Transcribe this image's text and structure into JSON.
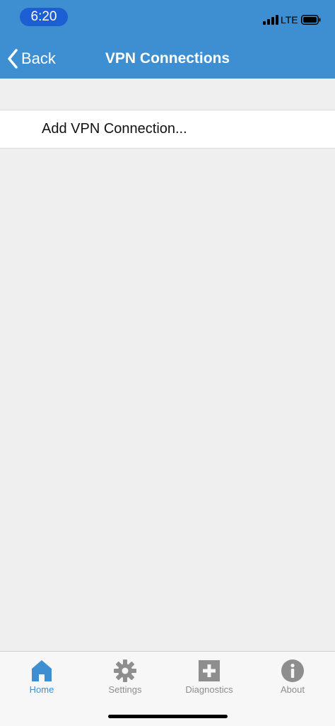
{
  "status_bar": {
    "time": "6:20",
    "network": "LTE"
  },
  "header": {
    "back_label": "Back",
    "title": "VPN Connections",
    "background_color": "#3d8fd1"
  },
  "list": {
    "items": [
      {
        "label": "Add VPN Connection..."
      }
    ]
  },
  "tabbar": {
    "tabs": [
      {
        "label": "Home",
        "icon": "home-icon",
        "active": true
      },
      {
        "label": "Settings",
        "icon": "gear-icon",
        "active": false
      },
      {
        "label": "Diagnostics",
        "icon": "plus-square-icon",
        "active": false
      },
      {
        "label": "About",
        "icon": "info-icon",
        "active": false
      }
    ],
    "active_color": "#3d8fd1",
    "inactive_color": "#8e8e8e"
  }
}
